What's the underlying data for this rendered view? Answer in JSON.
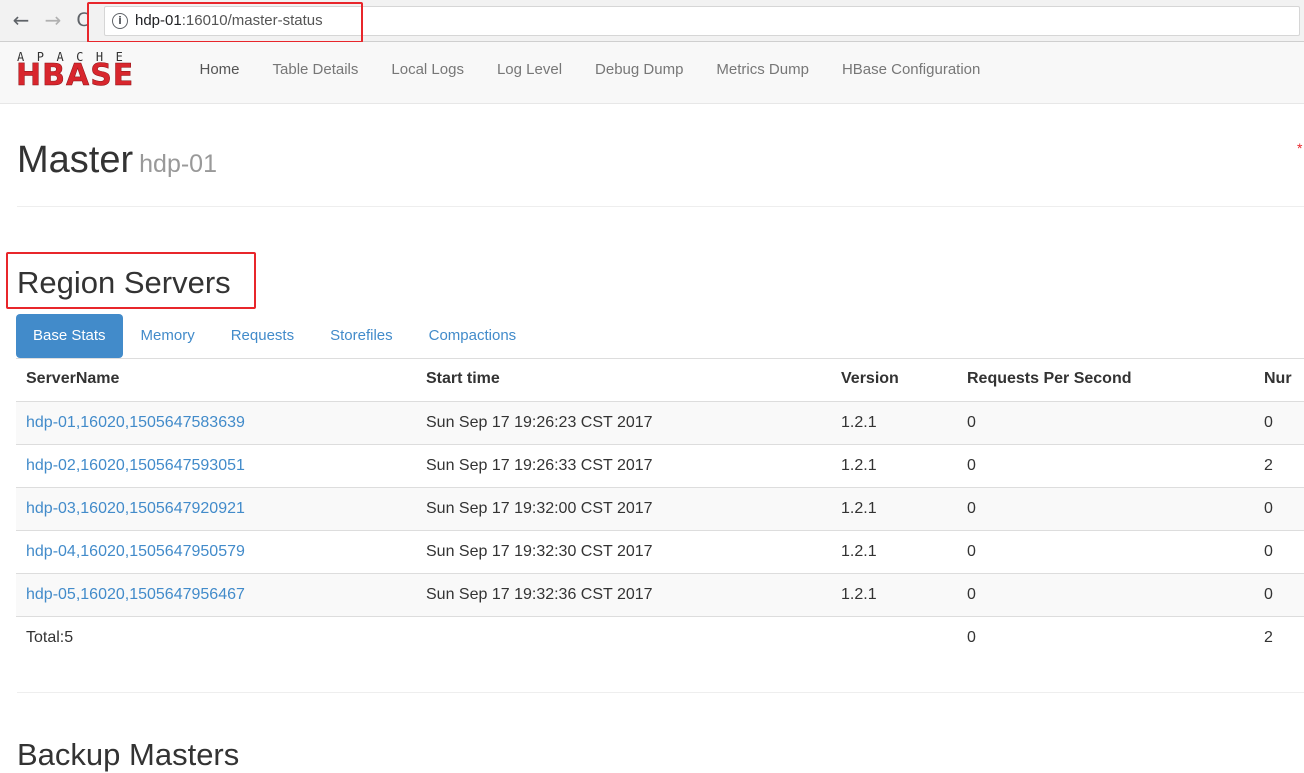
{
  "browser": {
    "back_icon": "←",
    "forward_icon": "→",
    "reload_icon": "C",
    "info_icon": "i",
    "url_host": "hdp-01",
    "url_rest": ":16010/master-status"
  },
  "navbar": {
    "logo_top": "APACHE",
    "logo_bottom": "HBASE",
    "links": [
      "Home",
      "Table Details",
      "Local Logs",
      "Log Level",
      "Debug Dump",
      "Metrics Dump",
      "HBase Configuration"
    ]
  },
  "page": {
    "title": "Master",
    "subtitle": "hdp-01"
  },
  "region_servers": {
    "title": "Region Servers",
    "tabs": [
      "Base Stats",
      "Memory",
      "Requests",
      "Storefiles",
      "Compactions"
    ],
    "active_tab": "Base Stats",
    "columns": [
      "ServerName",
      "Start time",
      "Version",
      "Requests Per Second",
      "Nur"
    ],
    "rows": [
      {
        "server": "hdp-01,16020,1505647583639",
        "start": "Sun Sep 17 19:26:23 CST 2017",
        "version": "1.2.1",
        "rps": "0",
        "num": "0"
      },
      {
        "server": "hdp-02,16020,1505647593051",
        "start": "Sun Sep 17 19:26:33 CST 2017",
        "version": "1.2.1",
        "rps": "0",
        "num": "2"
      },
      {
        "server": "hdp-03,16020,1505647920921",
        "start": "Sun Sep 17 19:32:00 CST 2017",
        "version": "1.2.1",
        "rps": "0",
        "num": "0"
      },
      {
        "server": "hdp-04,16020,1505647950579",
        "start": "Sun Sep 17 19:32:30 CST 2017",
        "version": "1.2.1",
        "rps": "0",
        "num": "0"
      },
      {
        "server": "hdp-05,16020,1505647956467",
        "start": "Sun Sep 17 19:32:36 CST 2017",
        "version": "1.2.1",
        "rps": "0",
        "num": "0"
      }
    ],
    "total": {
      "label": "Total:5",
      "rps": "0",
      "num": "2"
    }
  },
  "backup_masters": {
    "title": "Backup Masters"
  },
  "colors": {
    "link": "#428bca",
    "highlight": "#e8262b",
    "logo_red": "#d8262d"
  }
}
